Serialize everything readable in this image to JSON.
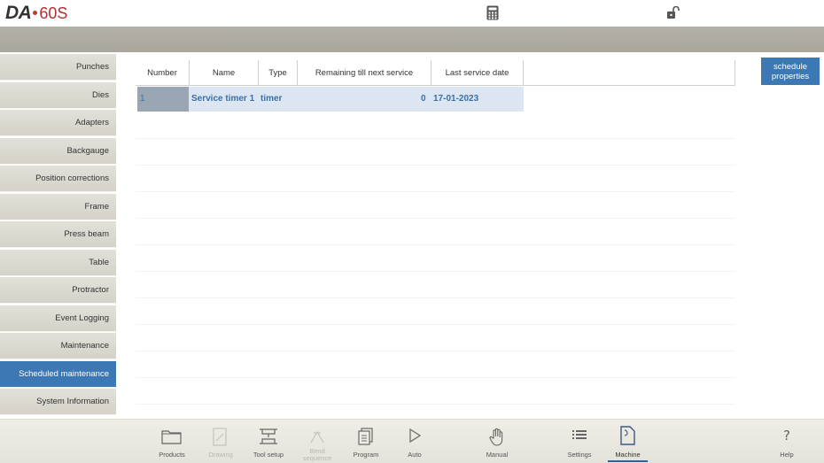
{
  "header": {
    "logo_brand": "DA",
    "logo_model": "60S",
    "icons": [
      "calculator-icon",
      "unlock-icon"
    ]
  },
  "sidebar": {
    "items": [
      {
        "label": "Punches",
        "active": false
      },
      {
        "label": "Dies",
        "active": false
      },
      {
        "label": "Adapters",
        "active": false
      },
      {
        "label": "Backgauge",
        "active": false
      },
      {
        "label": "Position corrections",
        "active": false
      },
      {
        "label": "Frame",
        "active": false
      },
      {
        "label": "Press beam",
        "active": false
      },
      {
        "label": "Table",
        "active": false
      },
      {
        "label": "Protractor",
        "active": false
      },
      {
        "label": "Event Logging",
        "active": false
      },
      {
        "label": "Maintenance",
        "active": false
      },
      {
        "label": "Scheduled maintenance",
        "active": true
      },
      {
        "label": "System Information",
        "active": false
      }
    ]
  },
  "table": {
    "columns": [
      "Number",
      "Name",
      "Type",
      "Remaining till next service",
      "Last service date"
    ],
    "rows": [
      {
        "number": "1",
        "name": "Service timer 1",
        "type": "timer",
        "remaining": "0",
        "last_service": "17-01-2023"
      }
    ]
  },
  "actions": {
    "schedule_properties_line1": "schedule",
    "schedule_properties_line2": "properties"
  },
  "bottom_nav": {
    "items": [
      {
        "label": "Products",
        "icon": "folder-icon",
        "enabled": true,
        "active": false
      },
      {
        "label": "Drawing",
        "icon": "drawing-icon",
        "enabled": false,
        "active": false
      },
      {
        "label": "Tool setup",
        "icon": "tool-setup-icon",
        "enabled": true,
        "active": false
      },
      {
        "label": "Bend sequence",
        "icon": "bend-sequence-icon",
        "enabled": false,
        "active": false
      },
      {
        "label": "Program",
        "icon": "program-icon",
        "enabled": true,
        "active": false
      },
      {
        "label": "Auto",
        "icon": "play-icon",
        "enabled": true,
        "active": false
      },
      {
        "label": "Manual",
        "icon": "hand-icon",
        "enabled": true,
        "active": false
      },
      {
        "label": "Settings",
        "icon": "list-icon",
        "enabled": true,
        "active": false
      },
      {
        "label": "Machine",
        "icon": "machine-icon",
        "enabled": true,
        "active": true
      },
      {
        "label": "Help",
        "icon": "help-icon",
        "enabled": true,
        "active": false
      }
    ]
  }
}
